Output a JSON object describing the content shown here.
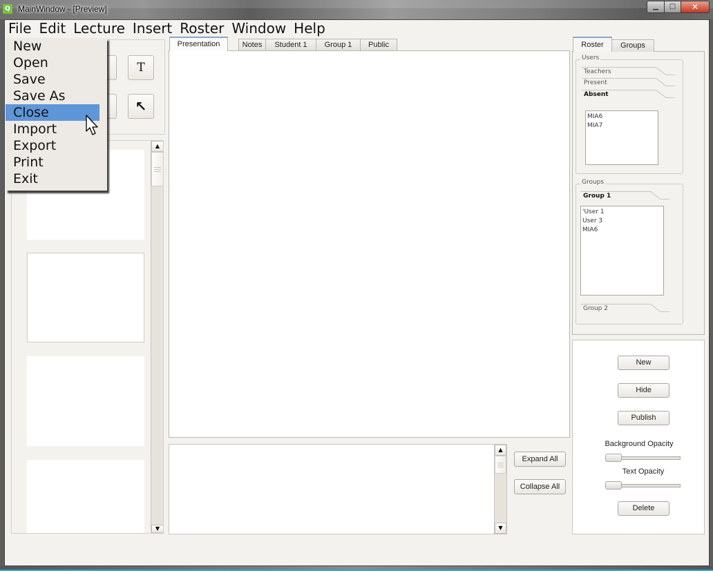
{
  "window": {
    "title": "MainWindow - [Preview]",
    "app_icon": "qt-icon",
    "caption_buttons": {
      "minimize": "minimize-icon",
      "maximize": "maximize-icon",
      "close": "close-icon"
    }
  },
  "menubar": {
    "items": [
      {
        "label": "File"
      },
      {
        "label": "Edit"
      },
      {
        "label": "Lecture"
      },
      {
        "label": "Insert"
      },
      {
        "label": "Roster"
      },
      {
        "label": "Window"
      },
      {
        "label": "Help"
      }
    ]
  },
  "file_menu": {
    "open": true,
    "highlighted": "Close",
    "highlight_color": "#5e96d8",
    "items": [
      {
        "label": "New"
      },
      {
        "label": "Open"
      },
      {
        "label": "Save"
      },
      {
        "label": "Save As"
      },
      {
        "label": "Close"
      },
      {
        "label": "Import"
      },
      {
        "label": "Export"
      },
      {
        "label": "Print"
      },
      {
        "label": "Exit"
      }
    ]
  },
  "tools": {
    "text_tool": {
      "glyph": "T",
      "icon": "text-tool-icon"
    },
    "select_tool": {
      "glyph": "↖",
      "icon": "arrow-select-icon"
    }
  },
  "center_tabs": {
    "active": "Presentation",
    "items": [
      {
        "label": "Presentation"
      },
      {
        "label": "Notes"
      },
      {
        "label": "Student 1"
      },
      {
        "label": "Group 1"
      },
      {
        "label": "Public"
      }
    ]
  },
  "notes_buttons": {
    "expand_all": "Expand All",
    "collapse_all": "Collapse All"
  },
  "scroll_glyphs": {
    "up": "▲",
    "down": "▼"
  },
  "right_tabs": {
    "active": "Roster",
    "items": [
      {
        "label": "Roster"
      },
      {
        "label": "Groups"
      }
    ]
  },
  "roster": {
    "users_title": "Users",
    "categories": [
      {
        "label": "Teachers",
        "selected": false
      },
      {
        "label": "Present",
        "selected": false
      },
      {
        "label": "Absent",
        "selected": true
      }
    ],
    "absent_users": [
      "MIA6",
      "MIA7"
    ],
    "groups_title": "Groups",
    "groups": [
      {
        "label": "Group 1",
        "selected": true,
        "members": [
          "'User 1",
          "User 3",
          "MIA6"
        ]
      },
      {
        "label": "Group 2",
        "selected": false
      }
    ]
  },
  "controls": {
    "new_label": "New",
    "hide_label": "Hide",
    "publish_label": "Publish",
    "background_opacity_label": "Background Opacity",
    "background_opacity_value": 0,
    "text_opacity_label": "Text Opacity",
    "text_opacity_value": 0,
    "delete_label": "Delete"
  }
}
